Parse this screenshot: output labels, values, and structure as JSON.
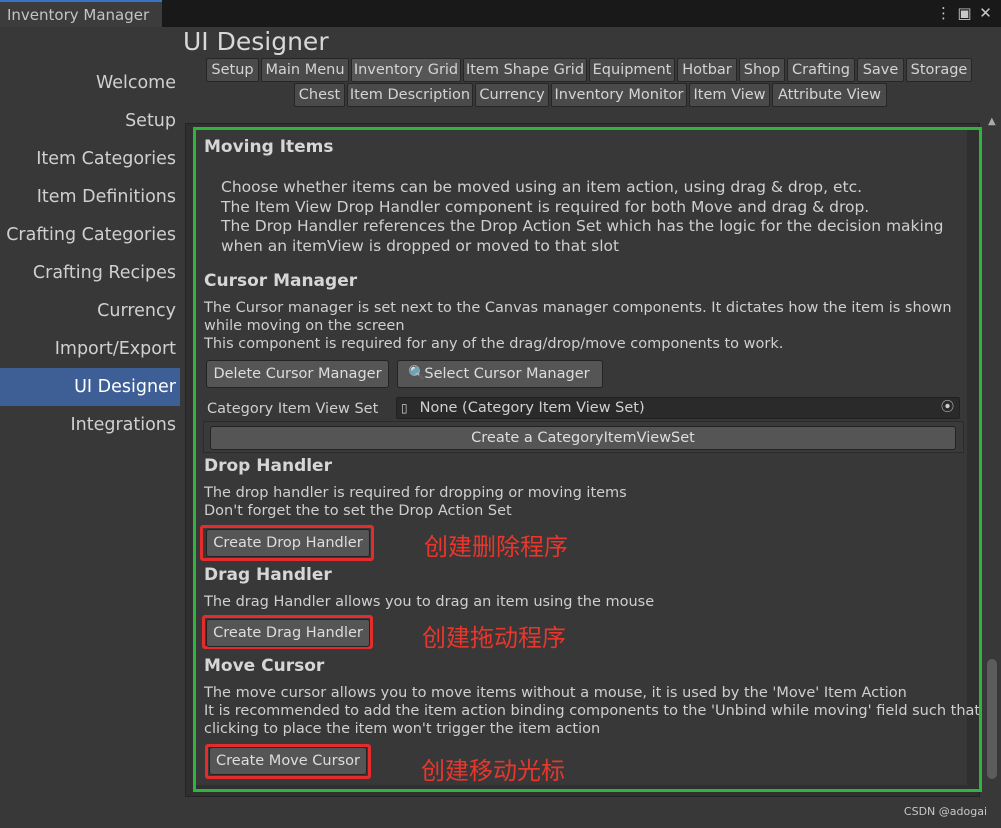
{
  "window": {
    "tab_title": "Inventory Manager",
    "menu_icon": "more-vertical-icon",
    "maximize_icon": "maximize-icon",
    "close_icon": "close-icon"
  },
  "sidebar": {
    "items": [
      {
        "label": "Welcome"
      },
      {
        "label": "Setup"
      },
      {
        "label": "Item Categories"
      },
      {
        "label": "Item Definitions"
      },
      {
        "label": "Crafting Categories"
      },
      {
        "label": "Crafting Recipes"
      },
      {
        "label": "Currency"
      },
      {
        "label": "Import/Export"
      },
      {
        "label": "UI Designer"
      },
      {
        "label": "Integrations"
      }
    ],
    "active": "UI Designer"
  },
  "main": {
    "title": "UI Designer",
    "tabs_row1": [
      "Setup",
      "Main Menu",
      "Inventory Grid",
      "Item Shape Grid",
      "Equipment",
      "Hotbar",
      "Shop",
      "Crafting",
      "Save",
      "Storage"
    ],
    "tabs_row2": [
      "Chest",
      "Item Description",
      "Currency",
      "Inventory Monitor",
      "Item View",
      "Attribute View"
    ],
    "selected_tab": "Inventory Grid"
  },
  "sections": {
    "moving_items": {
      "heading": "Moving Items",
      "lines": [
        "Choose whether items can be moved using an item action, using drag & drop, etc.",
        "The Item View Drop Handler component is required for both Move and drag & drop.",
        "The Drop Handler references the Drop Action Set which has the logic for the decision making",
        "when an itemView is dropped or moved to that slot"
      ]
    },
    "cursor_manager": {
      "heading": "Cursor Manager",
      "lines": [
        "The Cursor manager is set next to the Canvas manager components. It dictates how the item is shown",
        "while moving on the screen",
        "This component is required for any of the drag/drop/move components to work."
      ],
      "delete_button": "Delete Cursor Manager",
      "select_button": "Select Cursor Manager",
      "field_label": "Category Item View Set",
      "field_value": "None (Category Item View Set)",
      "create_button": "Create a CategoryItemViewSet"
    },
    "drop_handler": {
      "heading": "Drop Handler",
      "lines": [
        "The drop handler is required for dropping or moving items",
        "Don't forget the to set the Drop Action Set"
      ],
      "button": "Create Drop Handler",
      "note": "创建删除程序"
    },
    "drag_handler": {
      "heading": "Drag Handler",
      "lines": [
        "The drag Handler allows you to drag an item using the mouse"
      ],
      "button": "Create Drag Handler",
      "note": "创建拖动程序"
    },
    "move_cursor": {
      "heading": "Move Cursor",
      "lines": [
        "The move cursor allows you to move items without a mouse, it is used by the 'Move' Item Action",
        "It is recommended to add the item action binding components to the 'Unbind while moving' field such that",
        "clicking to place the item won't trigger the item action"
      ],
      "button": "Create Move Cursor",
      "note": "创建移动光标"
    }
  },
  "watermark": "CSDN @adogai",
  "colors": {
    "active_sidebar": "#3e5f96",
    "annotation_red": "#e32d2d",
    "annotation_green": "#2fb43c"
  }
}
